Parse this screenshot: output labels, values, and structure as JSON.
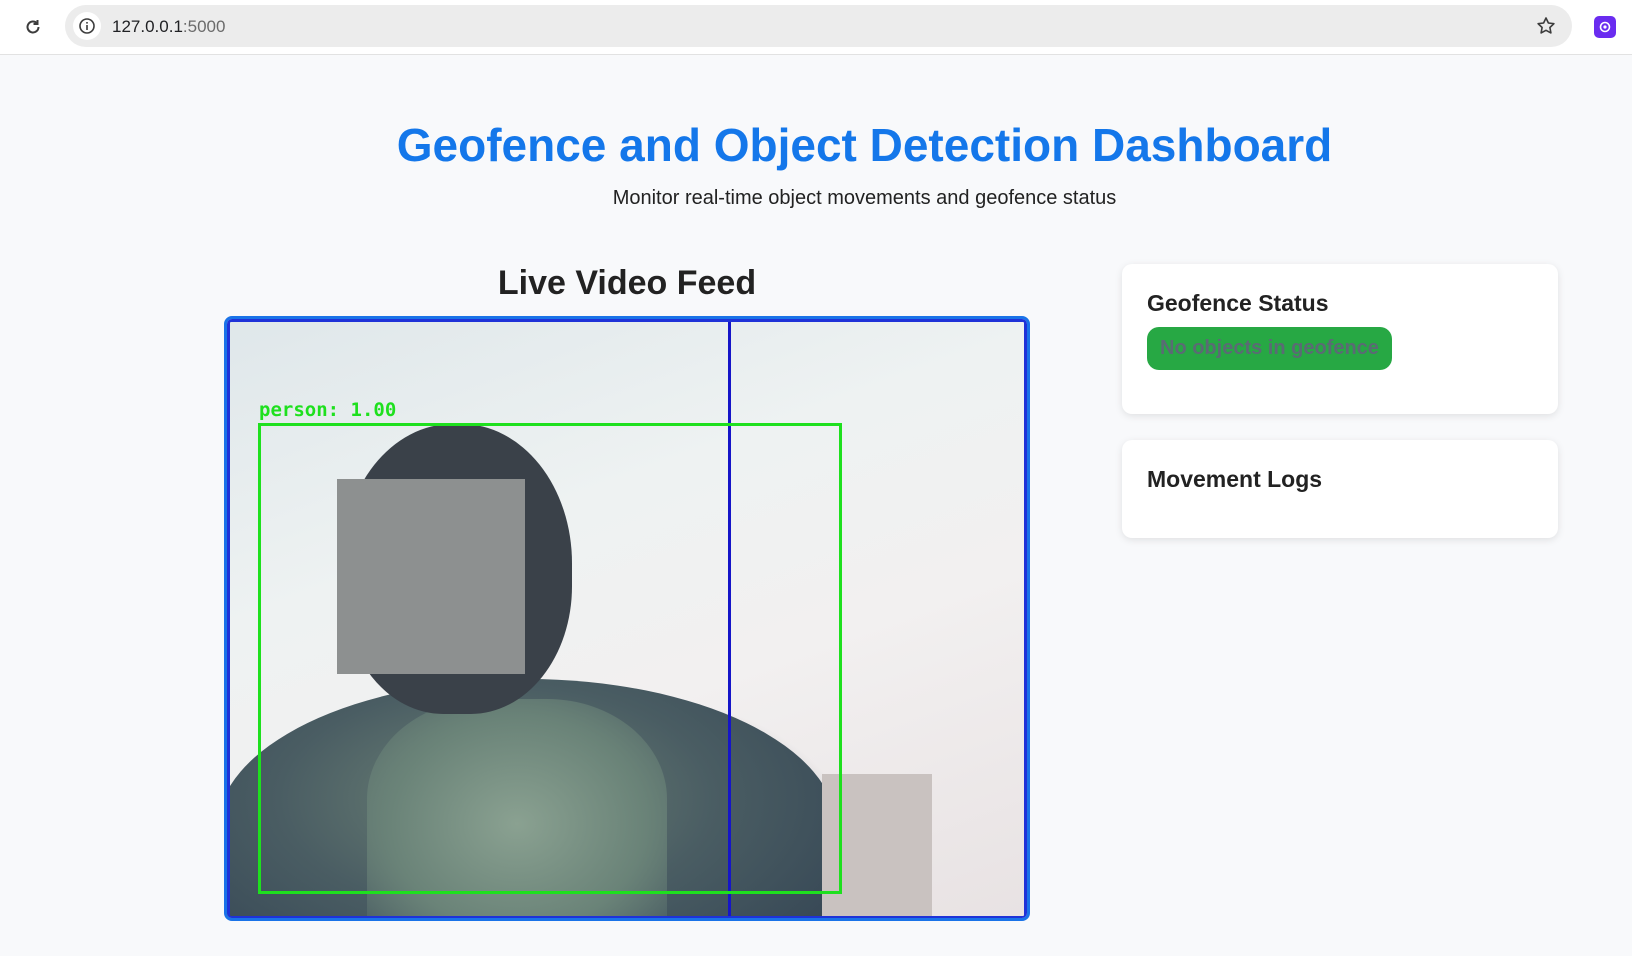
{
  "browser": {
    "url_host": "127.0.0.1",
    "url_port": ":5000",
    "reload_icon": "reload-icon",
    "info_icon": "info-icon",
    "star_icon": "star-icon",
    "extension_icon": "extension-icon"
  },
  "header": {
    "title": "Geofence and Object Detection Dashboard",
    "subtitle": "Monitor real-time object movements and geofence status"
  },
  "video": {
    "title": "Live Video Feed",
    "detection_label": "person: 1.00"
  },
  "geofence_status": {
    "title": "Geofence Status",
    "status_text": "No objects in geofence"
  },
  "movement_logs": {
    "title": "Movement Logs",
    "entries": []
  },
  "colors": {
    "title_blue": "#1477ea",
    "feed_border": "#1a73e8",
    "detection_green": "#1ee01e",
    "geofence_line": "#1515c8",
    "badge_green": "#27a844"
  }
}
